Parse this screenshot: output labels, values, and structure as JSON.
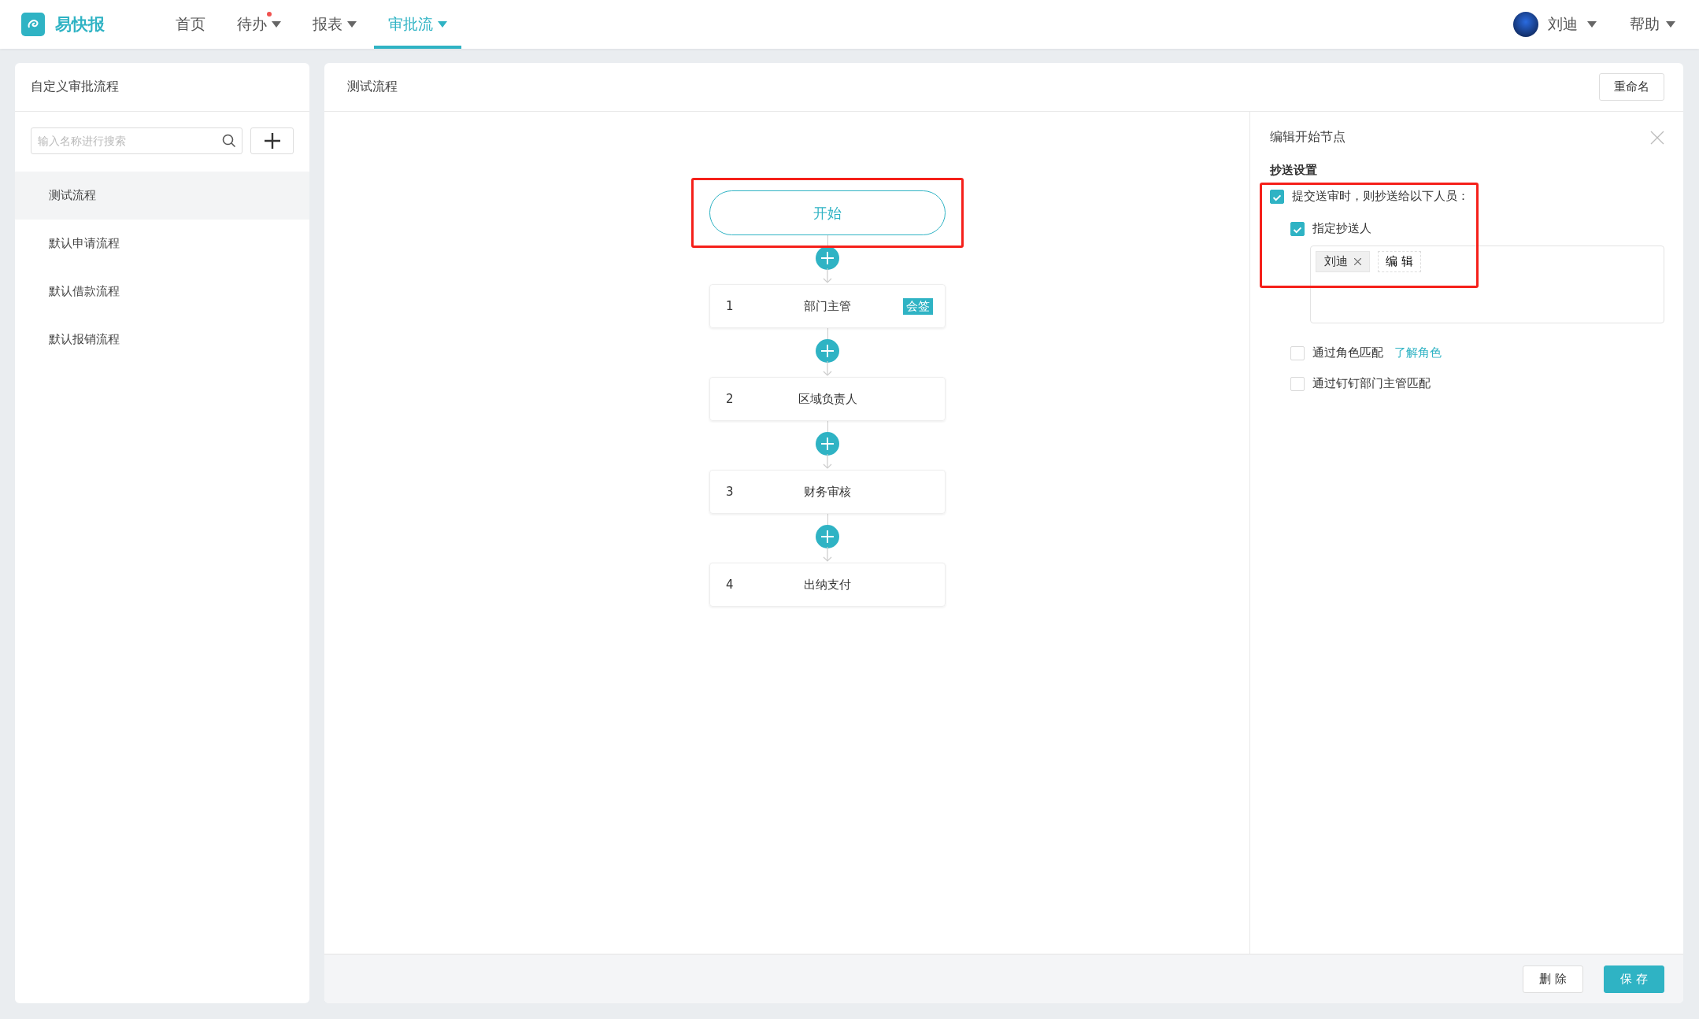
{
  "app": {
    "name": "易快报"
  },
  "nav": [
    {
      "label": "首页",
      "dropdown": false,
      "badge": false,
      "selected": false
    },
    {
      "label": "待办",
      "dropdown": true,
      "badge": true,
      "selected": false
    },
    {
      "label": "报表",
      "dropdown": true,
      "badge": false,
      "selected": false
    },
    {
      "label": "审批流",
      "dropdown": true,
      "badge": false,
      "selected": true
    }
  ],
  "user": {
    "name": "刘迪"
  },
  "help": {
    "label": "帮助"
  },
  "sidebar": {
    "title": "自定义审批流程",
    "search": {
      "placeholder": "输入名称进行搜索"
    },
    "items": [
      {
        "label": "测试流程",
        "selected": true
      },
      {
        "label": "默认申请流程",
        "selected": false
      },
      {
        "label": "默认借款流程",
        "selected": false
      },
      {
        "label": "默认报销流程",
        "selected": false
      }
    ]
  },
  "editor": {
    "title": "测试流程",
    "rename_button": "重命名",
    "start_node": {
      "label": "开始",
      "highlighted": true
    },
    "nodes": [
      {
        "number": "1",
        "label": "部门主管",
        "tag": "会签"
      },
      {
        "number": "2",
        "label": "区域负责人"
      },
      {
        "number": "3",
        "label": "财务审核"
      },
      {
        "number": "4",
        "label": "出纳支付"
      }
    ]
  },
  "panel": {
    "title": "编辑开始节点",
    "section": "抄送设置",
    "highlighted": true,
    "cc_option": {
      "label": "提交送审时，则抄送给以下人员：",
      "checked": true
    },
    "assign_option": {
      "label": "指定抄送人",
      "checked": true
    },
    "recipients": [
      {
        "name": "刘迪"
      }
    ],
    "edit_button": "编 辑",
    "match_options": [
      {
        "label": "通过角色匹配",
        "checked": false,
        "link": "了解角色"
      },
      {
        "label": "通过钉钉部门主管匹配",
        "checked": false
      }
    ]
  },
  "footer": {
    "buttons": [
      {
        "label": "删 除",
        "kind": "secondary"
      },
      {
        "label": "保 存",
        "kind": "primary"
      }
    ]
  }
}
